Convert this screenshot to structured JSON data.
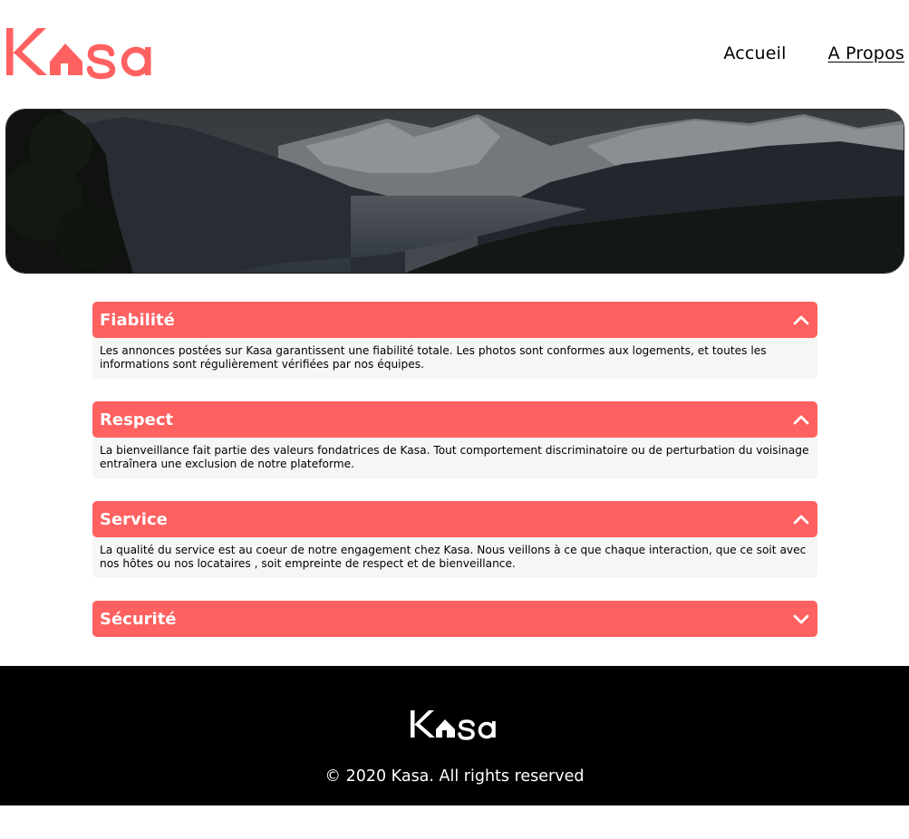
{
  "brand": {
    "name": "Kasa",
    "color": "#FF6060"
  },
  "nav": {
    "home": "Accueil",
    "about": "A Propos"
  },
  "collapses": [
    {
      "title": "Fiabilité",
      "open": true,
      "text": "Les annonces postées sur Kasa garantissent une fiabilité totale. Les photos sont conformes aux logements, et toutes les informations sont régulièrement vérifiées par nos équipes."
    },
    {
      "title": "Respect",
      "open": true,
      "text": "La bienveillance fait partie des valeurs fondatrices de Kasa. Tout comportement discriminatoire ou de perturbation du voisinage entraînera une exclusion de notre plateforme."
    },
    {
      "title": "Service",
      "open": true,
      "text": "La qualité du service est au coeur de notre engagement chez Kasa. Nous veillons à ce que chaque interaction, que ce soit avec nos hôtes ou nos locataires , soit empreinte de respect et de bienveillance."
    },
    {
      "title": "Sécurité",
      "open": false,
      "text": ""
    }
  ],
  "footer": {
    "copyright": "© 2020 Kasa. All rights reserved"
  }
}
